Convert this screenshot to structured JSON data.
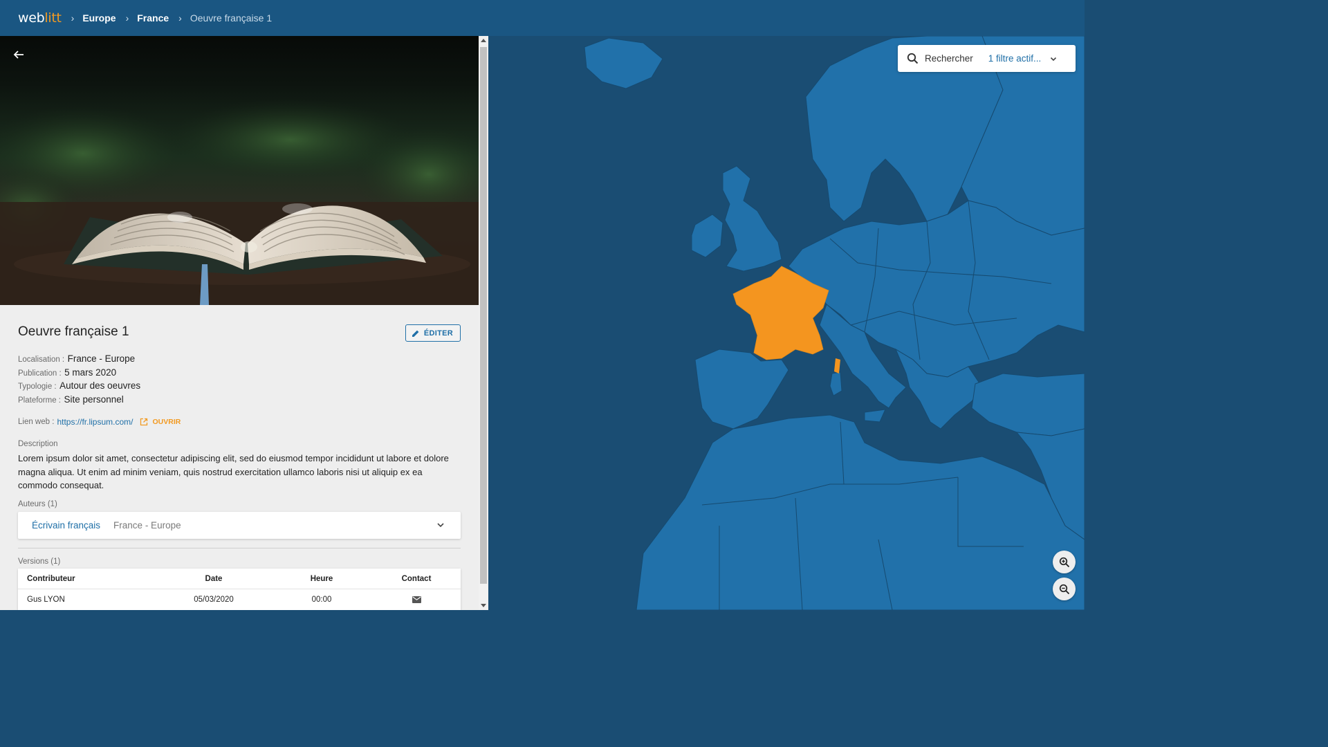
{
  "app": {
    "logo_main": "web",
    "logo_accent": "litt"
  },
  "breadcrumb": {
    "items": [
      "Europe",
      "France",
      "Oeuvre française 1"
    ]
  },
  "work": {
    "title": "Oeuvre française 1",
    "edit_label": "ÉDITER",
    "meta": [
      {
        "key": "Localisation :",
        "value": "France - Europe"
      },
      {
        "key": "Publication :",
        "value": "5 mars 2020"
      },
      {
        "key": "Typologie :",
        "value": "Autour des oeuvres"
      },
      {
        "key": "Plateforme :",
        "value": "Site personnel"
      }
    ],
    "weblink": {
      "key": "Lien web :",
      "url": "https://fr.lipsum.com/",
      "open_label": "OUVRIR"
    },
    "description_label": "Description",
    "description": "Lorem ipsum dolor sit amet, consectetur adipiscing elit, sed do eiusmod tempor incididunt ut labore et dolore magna aliqua. Ut enim ad minim veniam, quis nostrud exercitation ullamco laboris nisi ut aliquip ex ea commodo consequat.",
    "authors_label": "Auteurs (1)",
    "authors": [
      {
        "name": "Écrivain français",
        "location": "France - Europe"
      }
    ],
    "versions_label": "Versions (1)",
    "versions_columns": [
      "Contributeur",
      "Date",
      "Heure",
      "Contact"
    ],
    "versions": [
      {
        "contributor": "Gus LYON",
        "date": "05/03/2020",
        "time": "00:00"
      }
    ]
  },
  "map": {
    "search_placeholder": "Rechercher",
    "filter_label": "1 filtre actif...",
    "highlighted_country": "France",
    "colors": {
      "sea": "#1a4d73",
      "land": "#2171aa",
      "border": "#164a70",
      "highlight": "#f4951f"
    }
  },
  "icons": {
    "back": "arrow-left-icon",
    "edit": "pencil-icon",
    "open": "external-link-icon",
    "expand": "chevron-down-icon",
    "contact": "mail-icon",
    "search": "search-icon",
    "zoom_in": "zoom-in-icon",
    "zoom_out": "zoom-out-icon"
  }
}
